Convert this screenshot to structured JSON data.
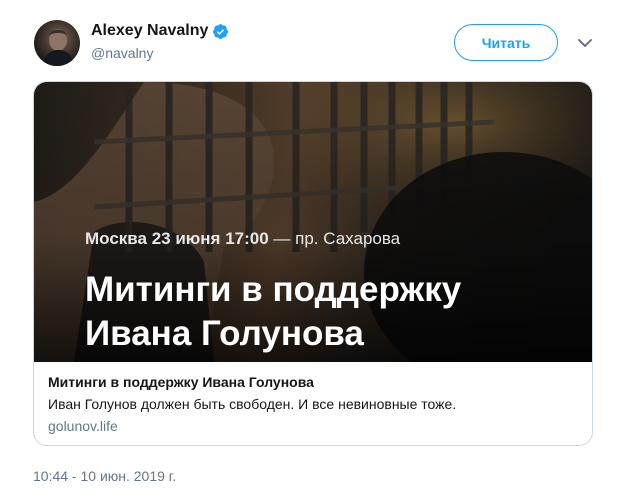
{
  "author": {
    "name": "Alexey Navalny",
    "handle": "@navalny",
    "verified": true
  },
  "follow_button": {
    "label": "Читать"
  },
  "icons": {
    "verified": "verified-badge-icon",
    "menu": "chevron-down-icon"
  },
  "card": {
    "image": {
      "subtitle_bold": "Москва 23 июня 17:00",
      "subtitle_light": "— пр. Сахарова",
      "title_line1": "Митинги в поддержку",
      "title_line2": "Ивана Голунова"
    },
    "title": "Митинги в поддержку Ивана Голунова",
    "description": "Иван Голунов должен быть свободен. И все невиновные тоже.",
    "domain": "golunov.life"
  },
  "timestamp": "10:44 - 10 июн. 2019 г.",
  "colors": {
    "accent": "#1da1f2",
    "text": "#14171a",
    "secondary": "#657786",
    "border": "#ccd6dd"
  }
}
